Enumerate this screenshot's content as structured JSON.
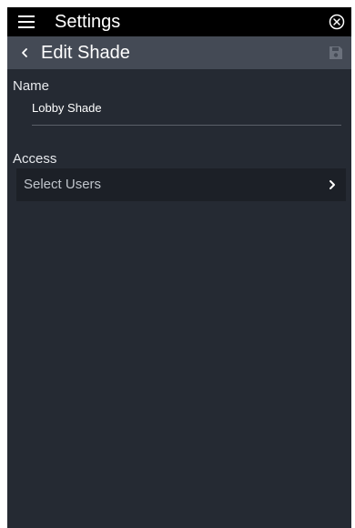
{
  "app": {
    "title": "Settings"
  },
  "header": {
    "title": "Edit Shade"
  },
  "form": {
    "name_label": "Name",
    "name_value": "Lobby Shade",
    "access_label": "Access",
    "select_users_label": "Select Users"
  },
  "icons": {
    "menu": "hamburger-menu-icon",
    "close": "close-circle-icon",
    "back": "chevron-left-icon",
    "save": "save-icon",
    "next": "chevron-right-icon"
  },
  "colors": {
    "topbar": "#000000",
    "subbar": "#444a55",
    "background": "#252a33",
    "row": "#1c2027"
  }
}
